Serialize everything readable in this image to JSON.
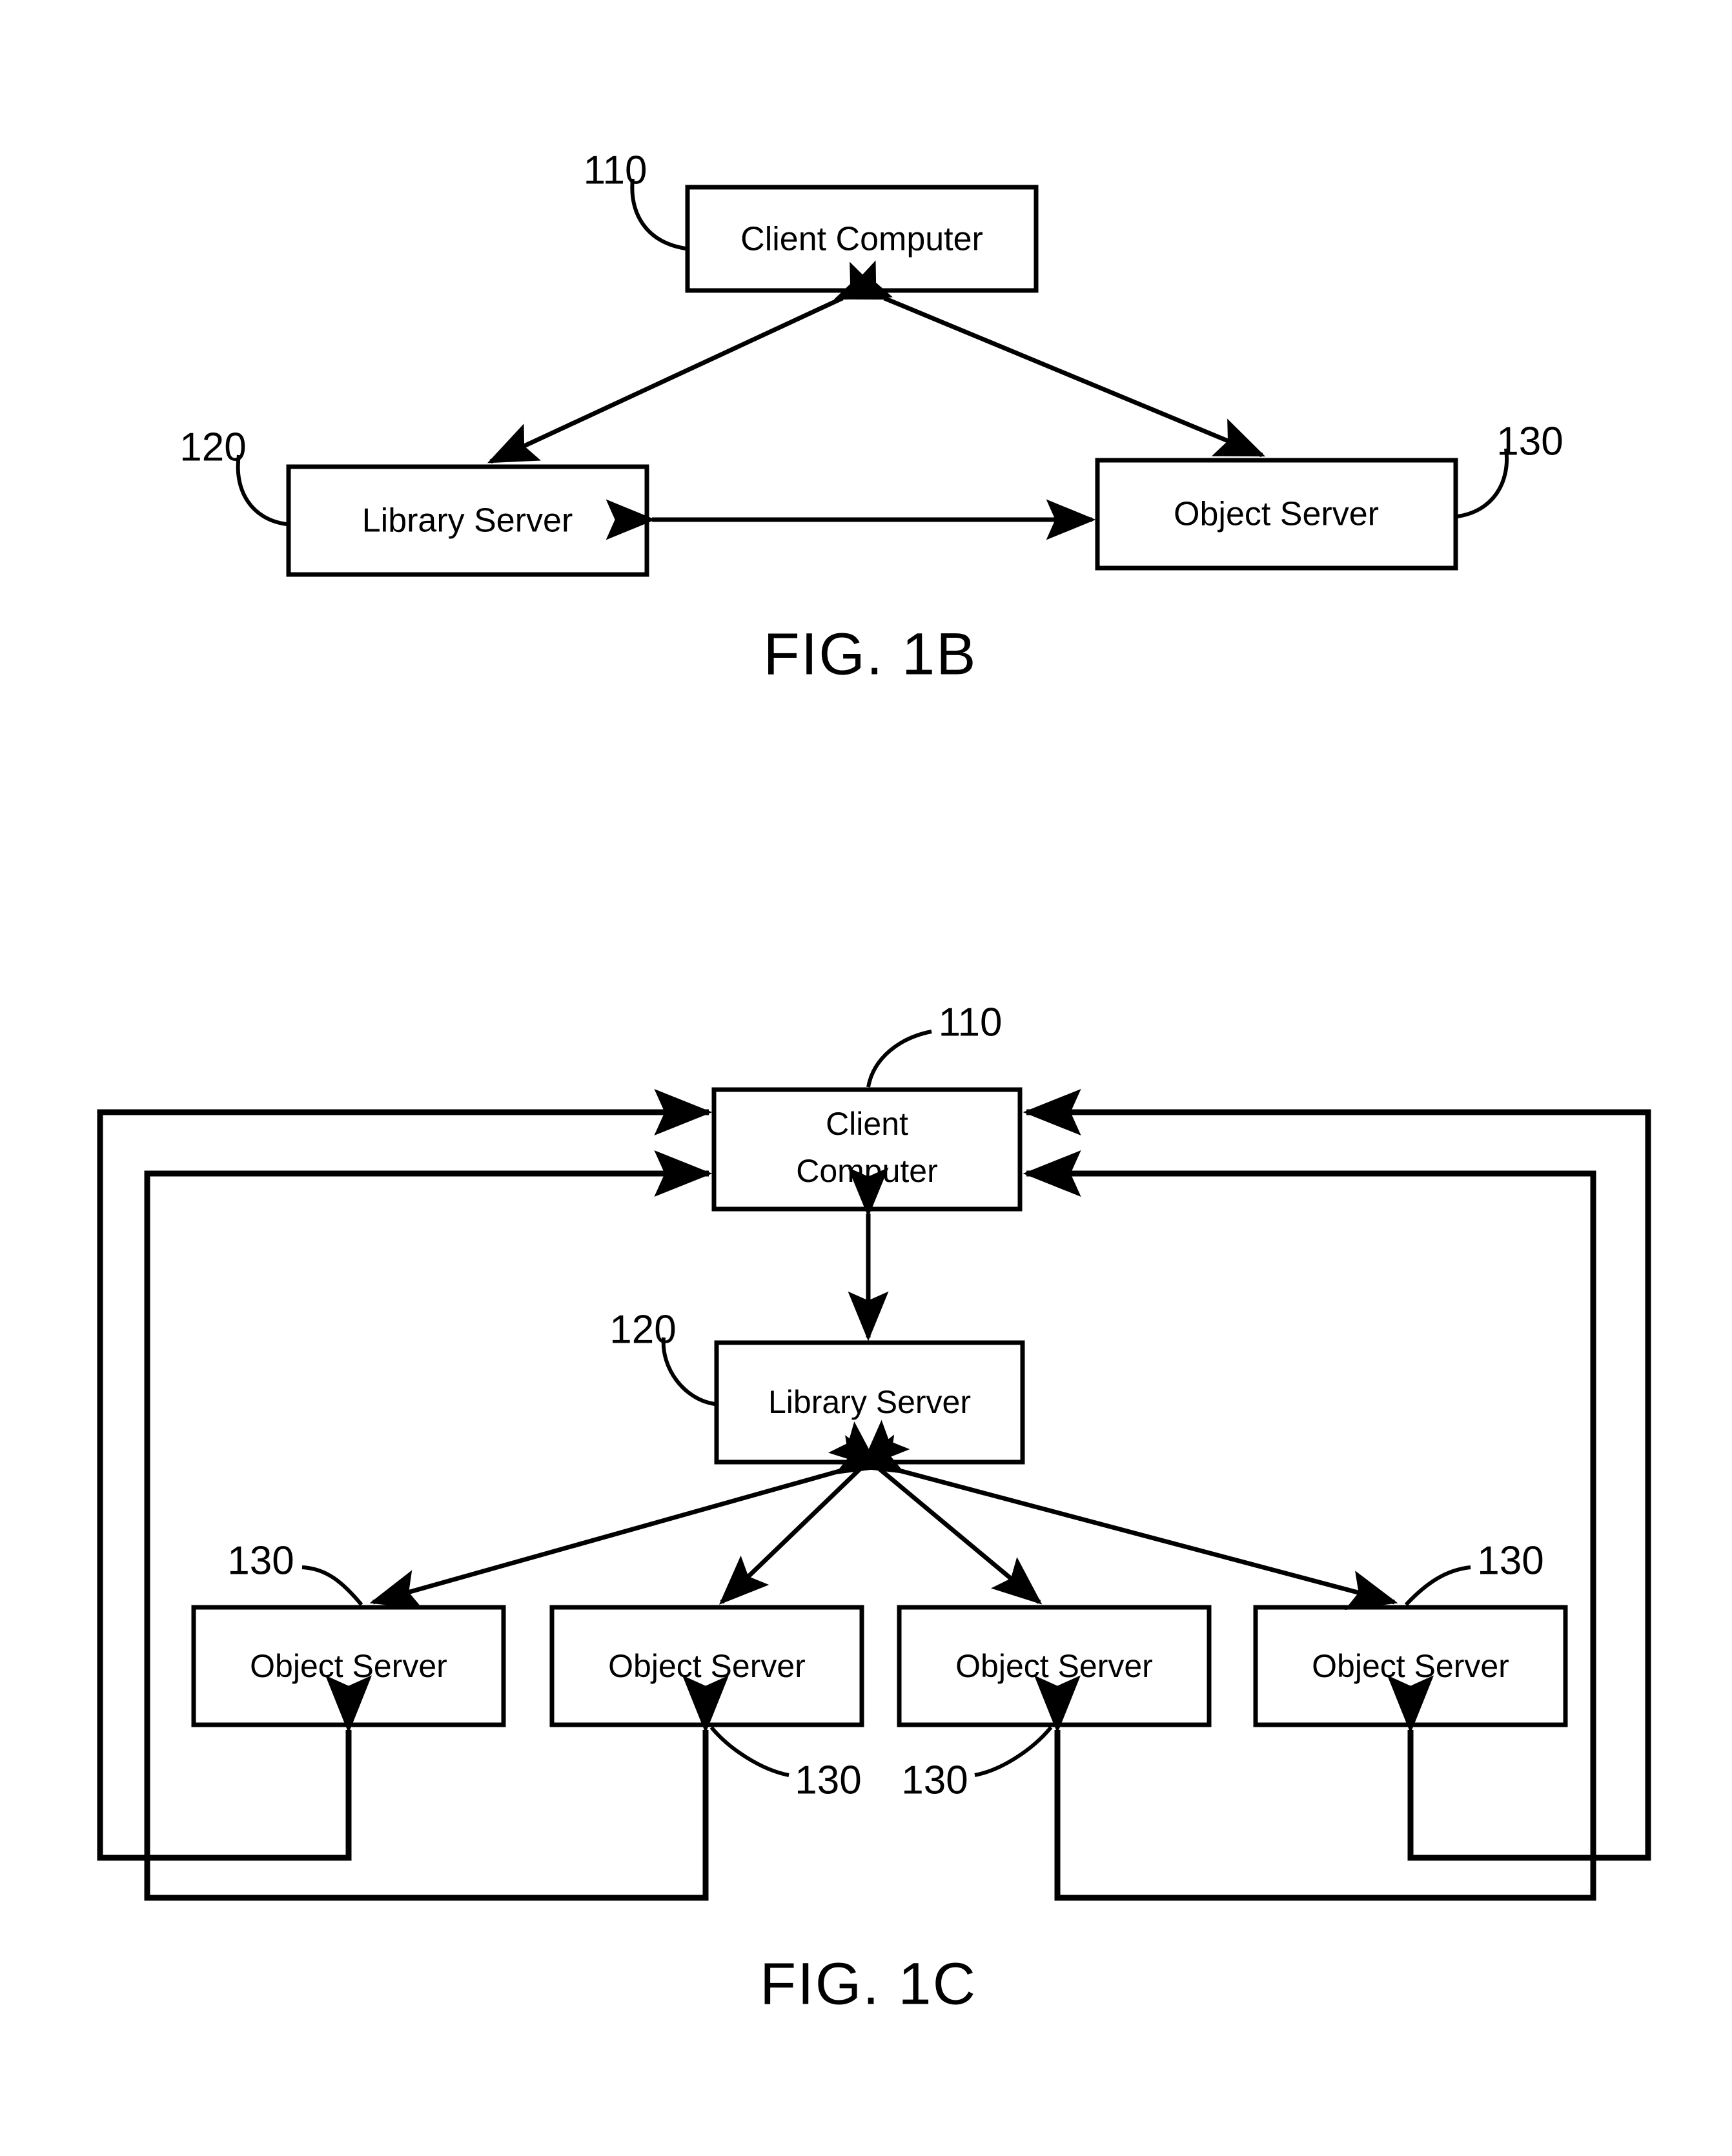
{
  "document": {
    "type": "patent-figure-sheet",
    "figures": [
      {
        "id": "fig1b",
        "caption": "FIG. 1B",
        "nodes": [
          {
            "id": "client",
            "label": "Client Computer",
            "ref": "110"
          },
          {
            "id": "library",
            "label": "Library Server",
            "ref": "120"
          },
          {
            "id": "object",
            "label": "Object Server",
            "ref": "130"
          }
        ],
        "connections": [
          {
            "from": "client",
            "to": "library",
            "style": "bidirectional"
          },
          {
            "from": "client",
            "to": "object",
            "style": "bidirectional"
          },
          {
            "from": "library",
            "to": "object",
            "style": "bidirectional"
          }
        ]
      },
      {
        "id": "fig1c",
        "caption": "FIG. 1C",
        "nodes": [
          {
            "id": "client",
            "label_line1": "Client",
            "label_line2": "Computer",
            "ref": "110"
          },
          {
            "id": "library",
            "label": "Library Server",
            "ref": "120"
          },
          {
            "id": "os1",
            "label": "Object Server",
            "ref": "130"
          },
          {
            "id": "os2",
            "label": "Object Server",
            "ref": "130"
          },
          {
            "id": "os3",
            "label": "Object Server",
            "ref": "130"
          },
          {
            "id": "os4",
            "label": "Object Server",
            "ref": "130"
          }
        ],
        "connections": [
          {
            "from": "client",
            "to": "library",
            "style": "bidirectional"
          },
          {
            "from": "library",
            "to": "os1",
            "style": "bidirectional"
          },
          {
            "from": "library",
            "to": "os2",
            "style": "bidirectional"
          },
          {
            "from": "library",
            "to": "os3",
            "style": "bidirectional"
          },
          {
            "from": "library",
            "to": "os4",
            "style": "bidirectional"
          },
          {
            "from": "os1",
            "to": "client",
            "style": "loop-left-outer"
          },
          {
            "from": "os2",
            "to": "client",
            "style": "loop-left-inner"
          },
          {
            "from": "os3",
            "to": "client",
            "style": "loop-right-inner"
          },
          {
            "from": "os4",
            "to": "client",
            "style": "loop-right-outer"
          }
        ]
      }
    ],
    "ref_numerals": {
      "client_computer": "110",
      "library_server": "120",
      "object_server": "130"
    },
    "colors": {
      "ink": "#000000",
      "paper": "#ffffff"
    }
  }
}
